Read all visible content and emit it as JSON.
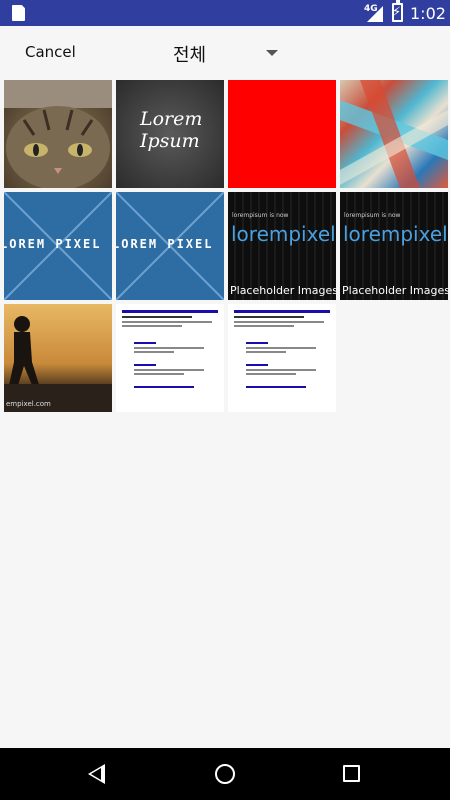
{
  "status_bar": {
    "time": "1:02",
    "network": "4G",
    "icons": [
      "sd-card-icon",
      "signal-icon",
      "battery-charging-icon"
    ]
  },
  "toolbar": {
    "cancel_label": "Cancel",
    "album_title": "전체",
    "dropdown_icon": "dropdown-arrow-icon"
  },
  "gallery": {
    "items": [
      {
        "name": "cat-photo",
        "caption": ""
      },
      {
        "name": "lorem-ipsum-chalkboard",
        "caption": "Lorem Ipsum"
      },
      {
        "name": "red-square",
        "caption": "",
        "color": "#ff0000"
      },
      {
        "name": "abstract-paint",
        "caption": ""
      },
      {
        "name": "lorem-pixel-banner",
        "caption": "LOREM PIXEL"
      },
      {
        "name": "lorem-pixel-banner",
        "caption": "LOREM PIXEL"
      },
      {
        "name": "lorempixel-dark",
        "caption": "lorempixel",
        "subcaption": "lorempisum is now",
        "footer": "Placeholder Images f"
      },
      {
        "name": "lorempixel-dark",
        "caption": "lorempixel",
        "subcaption": "lorempisum is now",
        "footer": "Placeholder Images f"
      },
      {
        "name": "runner-silhouette",
        "caption": "",
        "footer": "empixel.com"
      },
      {
        "name": "web-search-result",
        "caption": ""
      },
      {
        "name": "web-search-result",
        "caption": ""
      }
    ]
  },
  "nav_bar": {
    "icons": [
      "back-icon",
      "home-icon",
      "recent-apps-icon"
    ]
  }
}
